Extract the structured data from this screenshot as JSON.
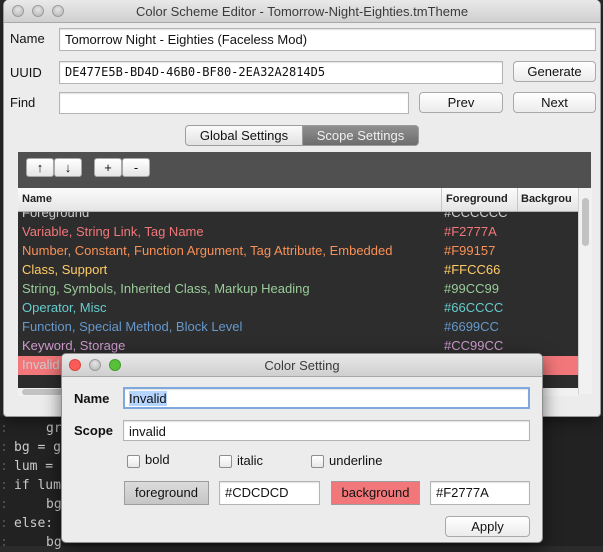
{
  "background_code": {
    "lines": [
      {
        "indent": "    ",
        "text": "gr"
      },
      {
        "indent": "",
        "text": "bg = g"
      },
      {
        "indent": "",
        "text": "lum ="
      },
      {
        "indent": "",
        "text": "if lum"
      },
      {
        "indent": "    ",
        "text": "bg"
      },
      {
        "indent": "",
        "text": "else:"
      },
      {
        "indent": "    ",
        "text": "bg"
      }
    ]
  },
  "main_window": {
    "title": "Color Scheme Editor - Tomorrow-Night-Eighties.tmTheme",
    "name_label": "Name",
    "name_value": "Tomorrow Night - Eighties (Faceless Mod)",
    "uuid_label": "UUID",
    "uuid_value": "DE477E5B-BD4D-46B0-BF80-2EA32A2814D5",
    "generate_label": "Generate",
    "find_label": "Find",
    "find_value": "",
    "prev_label": "Prev",
    "next_label": "Next",
    "tabs": [
      {
        "label": "Global Settings",
        "active": true
      },
      {
        "label": "Scope Settings",
        "active": false
      }
    ],
    "toolbar": {
      "up_label": "↑",
      "down_label": "↓",
      "add_label": "+",
      "remove_label": "-"
    },
    "table": {
      "columns": [
        "Name",
        "Foreground",
        "Backgrou"
      ],
      "rows": [
        {
          "name": "Foreground",
          "foreground": "#CCCCCC",
          "color": "#cccccc"
        },
        {
          "name": "Variable, String Link, Tag Name",
          "foreground": "#F2777A",
          "color": "#f2777a"
        },
        {
          "name": "Number, Constant, Function Argument, Tag Attribute, Embedded",
          "foreground": "#F99157",
          "color": "#f99157"
        },
        {
          "name": "Class, Support",
          "foreground": "#FFCC66",
          "color": "#ffcc66"
        },
        {
          "name": "String, Symbols, Inherited Class, Markup Heading",
          "foreground": "#99CC99",
          "color": "#99cc99"
        },
        {
          "name": "Operator, Misc",
          "foreground": "#66CCCC",
          "color": "#66cccc"
        },
        {
          "name": "Function, Special Method, Block Level",
          "foreground": "#6699CC",
          "color": "#6699cc"
        },
        {
          "name": "Keyword, Storage",
          "foreground": "#CC99CC",
          "color": "#cc99cc"
        },
        {
          "name": "Invalid",
          "foreground": "#F2777A",
          "color": "#cdcdcd",
          "selected": true
        }
      ]
    }
  },
  "color_dialog": {
    "title": "Color Setting",
    "name_label": "Name",
    "name_value": "Invalid",
    "scope_label": "Scope",
    "scope_value": "invalid",
    "bold_label": "bold",
    "italic_label": "italic",
    "underline_label": "underline",
    "bold_checked": false,
    "italic_checked": false,
    "underline_checked": false,
    "foreground_label": "foreground",
    "foreground_value": "#CDCDCD",
    "background_label": "background",
    "background_value": "#F2777A",
    "background_color": "#f2777a",
    "apply_label": "Apply"
  },
  "colors": {
    "editor_bg": "#2d2d2d",
    "selection": "#f2777a",
    "close_red": "#fc5b57",
    "minimize_yellow": "#e5bf3c",
    "zoom_green": "#57c038"
  }
}
